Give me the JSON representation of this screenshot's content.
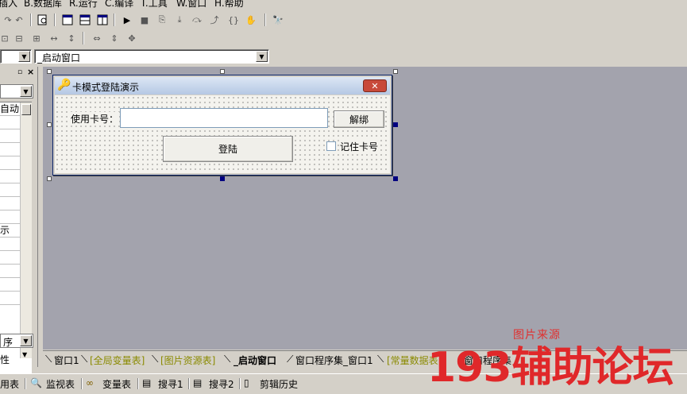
{
  "menu": [
    {
      "label": "插入"
    },
    {
      "label": "B.数据库"
    },
    {
      "label": "R.运行"
    },
    {
      "label": "C.编译"
    },
    {
      "label": "T.工具"
    },
    {
      "label": "W.窗口"
    },
    {
      "label": "H.帮助"
    }
  ],
  "combo_row": {
    "left_value": "",
    "window_value": "_启动窗口"
  },
  "left_panel": {
    "rows": [
      "自动",
      "",
      "",
      "",
      "",
      "",
      "",
      "",
      "",
      "示",
      "",
      "",
      "",
      "",
      ""
    ],
    "bottom_combo": "序",
    "bottom_label": "性"
  },
  "design_window": {
    "title": "卡模式登陆演示",
    "card_label": "使用卡号：",
    "card_input_value": "",
    "unbind_button": "解绑",
    "login_button": "登陆",
    "remember_label": "记住卡号",
    "remember_checked": false
  },
  "tabs": [
    {
      "label": "窗口1",
      "style": "normal"
    },
    {
      "label": "[全局变量表]",
      "style": "green"
    },
    {
      "label": "[图片资源表]",
      "style": "green"
    },
    {
      "label": "_启动窗口",
      "style": "active"
    },
    {
      "label": "窗口程序集_窗口1",
      "style": "normal"
    },
    {
      "label": "[常量数据表]",
      "style": "green"
    },
    {
      "label": "窗口程序集",
      "style": "normal"
    }
  ],
  "bottom_bar": [
    {
      "label": "用表",
      "icon": ""
    },
    {
      "label": "监视表",
      "icon": "search-icon"
    },
    {
      "label": "变量表",
      "icon": "variable-icon"
    },
    {
      "label": "搜寻1",
      "icon": "search-doc-icon"
    },
    {
      "label": "搜寻2",
      "icon": "search-doc-icon"
    },
    {
      "label": "剪辑历史",
      "icon": "clipboard-icon"
    }
  ],
  "watermark": {
    "top": "图片来源",
    "main": "193辅助论坛"
  }
}
